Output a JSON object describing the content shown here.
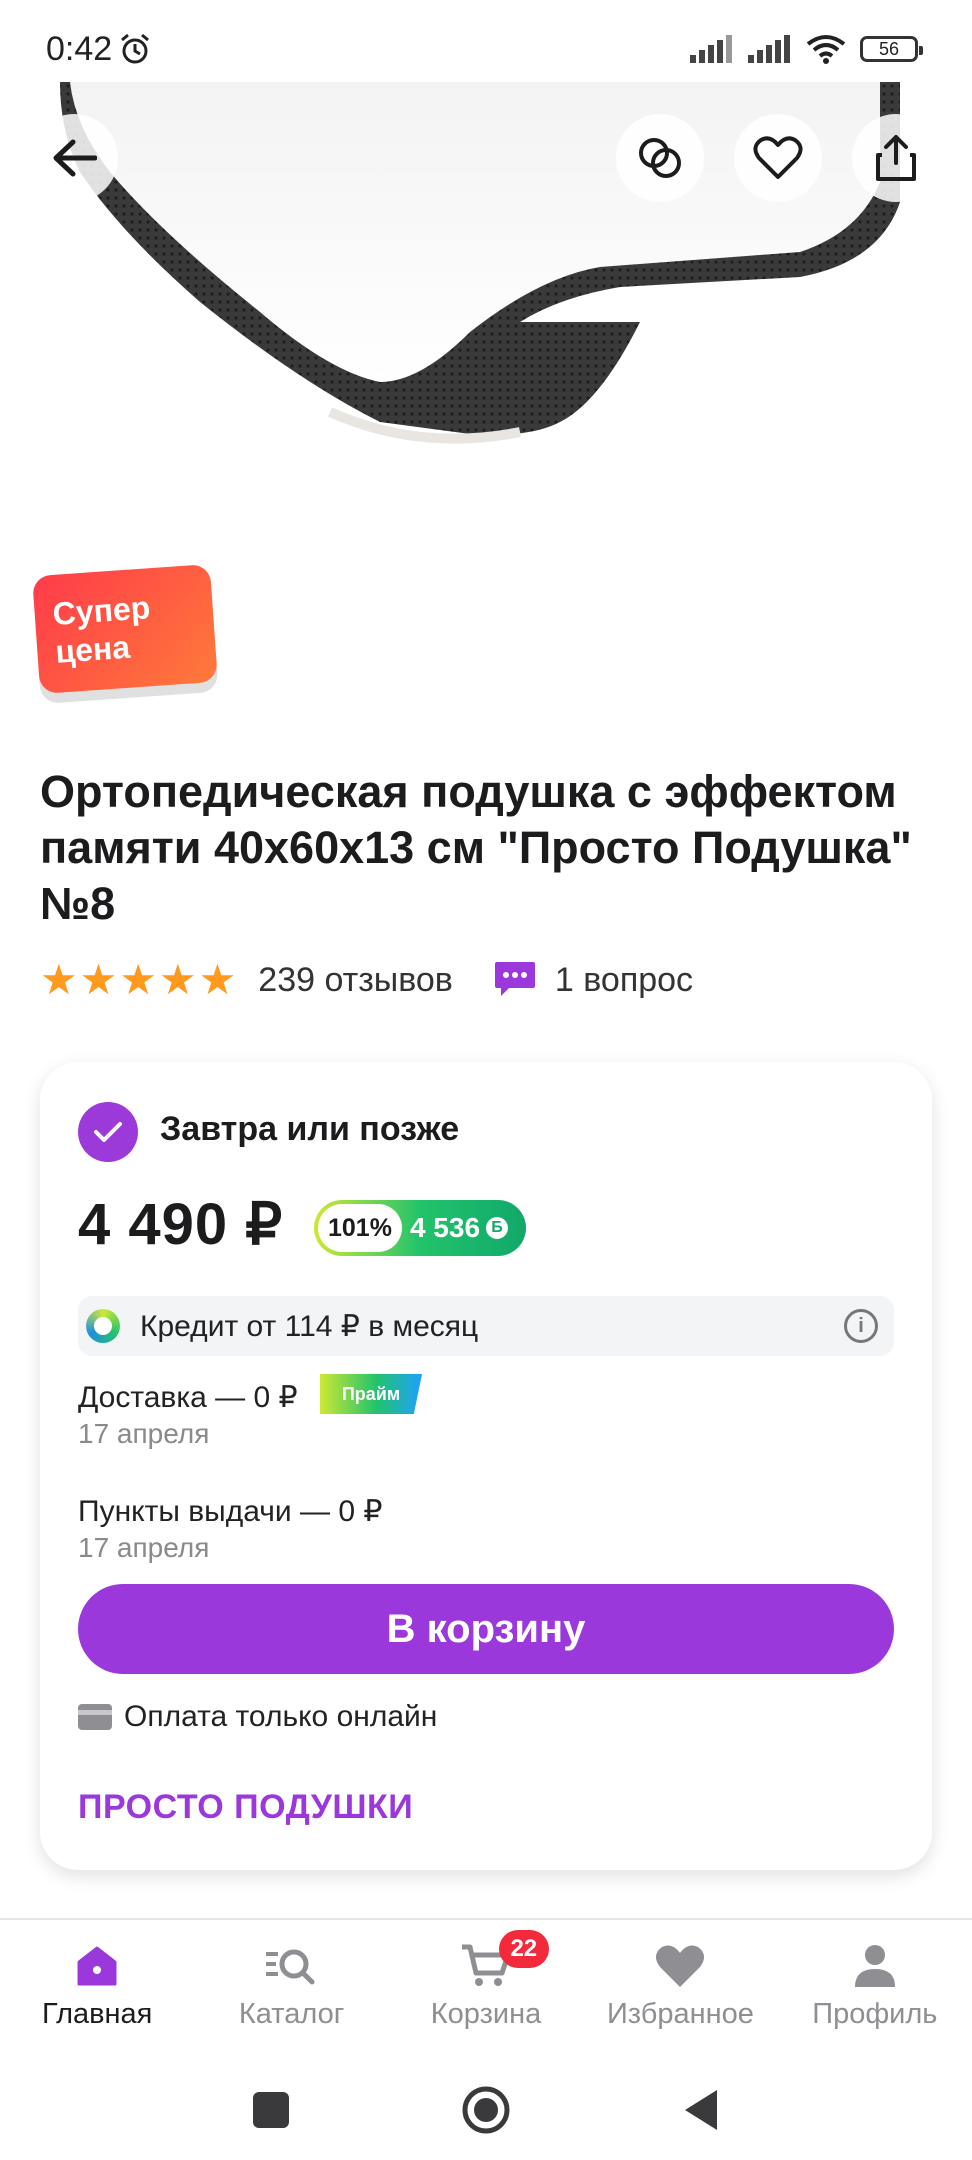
{
  "status_bar": {
    "time": "0:42",
    "battery": "56"
  },
  "badge": {
    "line1": "Супер",
    "line2": "цена"
  },
  "product": {
    "title": "Ортопедическая подушка с эффектом памяти 40x60x13 см \"Просто Подушка\" №8",
    "rating_stars": 5,
    "reviews": "239 отзывов",
    "questions": "1 вопрос"
  },
  "offer": {
    "delivery_title": "Завтра или позже",
    "price": "4 490 ₽",
    "bonus_percent": "101%",
    "bonus_value": "4 536",
    "credit": "Кредит от 114 ₽ в месяц",
    "shipping": [
      {
        "label": "Доставка — 0 ₽",
        "date": "17 апреля",
        "badge": "Прайм"
      },
      {
        "label": "Пункты выдачи — 0 ₽",
        "date": "17 апреля"
      }
    ],
    "cart_button": "В корзину",
    "payment_note": "Оплата только онлайн",
    "seller": "ПРОСТО ПОДУШКИ"
  },
  "bottom_nav": {
    "items": [
      {
        "label": "Главная",
        "icon": "home-icon",
        "active": true
      },
      {
        "label": "Каталог",
        "icon": "catalog-search-icon"
      },
      {
        "label": "Корзина",
        "icon": "cart-icon",
        "badge": "22"
      },
      {
        "label": "Избранное",
        "icon": "heart-icon"
      },
      {
        "label": "Профиль",
        "icon": "profile-icon"
      }
    ]
  },
  "colors": {
    "accent": "#9b38dc",
    "star": "#ff9a1f",
    "badge_red": "#f22a3c"
  }
}
